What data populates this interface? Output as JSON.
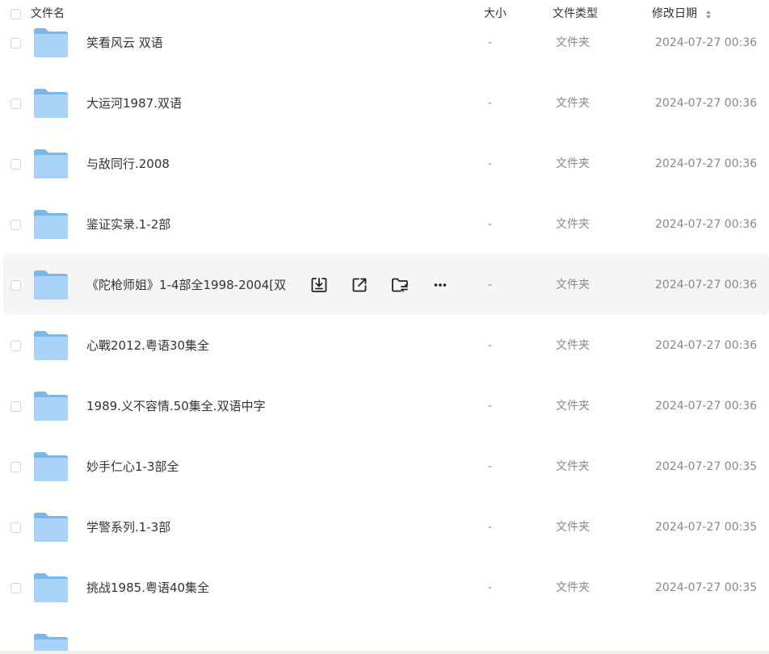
{
  "table": {
    "headers": {
      "name": "文件名",
      "size": "大小",
      "type": "文件类型",
      "modified": "修改日期"
    },
    "rows": [
      {
        "name": "笑看风云 双语",
        "size": "-",
        "type": "文件夹",
        "modified": "2024-07-27 00:36"
      },
      {
        "name": "大运河1987.双语",
        "size": "-",
        "type": "文件夹",
        "modified": "2024-07-27 00:36"
      },
      {
        "name": "与敌同行.2008",
        "size": "-",
        "type": "文件夹",
        "modified": "2024-07-27 00:36"
      },
      {
        "name": "鉴证实录.1-2部",
        "size": "-",
        "type": "文件夹",
        "modified": "2024-07-27 00:36"
      },
      {
        "name": "《陀枪师姐》1-4部全1998-2004[双",
        "size": "-",
        "type": "文件夹",
        "modified": "2024-07-27 00:36"
      },
      {
        "name": "心戰2012.粤语30集全",
        "size": "-",
        "type": "文件夹",
        "modified": "2024-07-27 00:36"
      },
      {
        "name": "1989.义不容情.50集全.双语中字",
        "size": "-",
        "type": "文件夹",
        "modified": "2024-07-27 00:36"
      },
      {
        "name": "妙手仁心1-3部全",
        "size": "-",
        "type": "文件夹",
        "modified": "2024-07-27 00:35"
      },
      {
        "name": "学警系列.1-3部",
        "size": "-",
        "type": "文件夹",
        "modified": "2024-07-27 00:35"
      },
      {
        "name": "挑战1985.粤语40集全",
        "size": "-",
        "type": "文件夹",
        "modified": "2024-07-27 00:35"
      }
    ],
    "hovered_row_actions": [
      "download-icon",
      "share-icon",
      "move-to-folder-icon",
      "more-icon"
    ],
    "sort_icon": "sort-updown-icon"
  },
  "colors": {
    "folder_top": "#7ab7ea",
    "folder_body": "#a8d2f8",
    "hover_bg": "#f5f5f6",
    "muted_text": "#888888"
  }
}
